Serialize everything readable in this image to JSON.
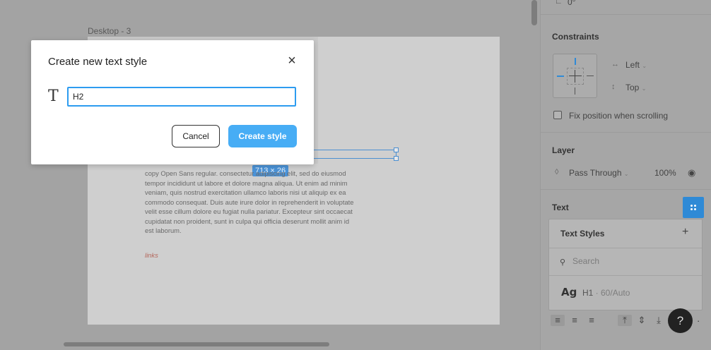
{
  "canvas": {
    "frame_label": "Desktop - 3",
    "size_badge": "713 × 26",
    "body_copy": "copy Open Sans regular. consectetur adipiscing elit, sed do eiusmod tempor incididunt ut labore et dolore magna aliqua. Ut enim ad minim veniam, quis nostrud exercitation ullamco laboris nisi ut aliquip ex ea commodo consequat. Duis aute irure dolor in reprehenderit in voluptate velit esse cillum dolore eu fugiat nulla pariatur. Excepteur sint occaecat cupidatat non proident, sunt in culpa qui officia deserunt mollit anim id est laborum.",
    "links_label": "links"
  },
  "panel": {
    "rotation_value": "0°",
    "constraints": {
      "title": "Constraints",
      "horizontal": "Left",
      "vertical": "Top",
      "fix_position_label": "Fix position when scrolling"
    },
    "layer": {
      "title": "Layer",
      "blend_mode": "Pass Through",
      "opacity": "100%"
    },
    "text": {
      "title": "Text"
    },
    "text_styles_popup": {
      "title": "Text Styles",
      "search_placeholder": "Search",
      "items": [
        {
          "preview": "Ag",
          "name": "H1",
          "meta": " · 60/Auto"
        }
      ]
    },
    "help_label": "?"
  },
  "modal": {
    "title": "Create new text style",
    "input_value": "H2",
    "cancel_label": "Cancel",
    "create_label": "Create style"
  },
  "colors": {
    "accent": "#47adf5",
    "input_border": "#2d9cf0",
    "selection": "#4b8fd1",
    "styles_button": "#2f8ad6"
  },
  "icons": {
    "close": "close-icon",
    "text_type": "text-type-icon",
    "search": "search-icon",
    "plus": "plus-icon",
    "eye": "eye-icon",
    "help": "help-icon"
  }
}
